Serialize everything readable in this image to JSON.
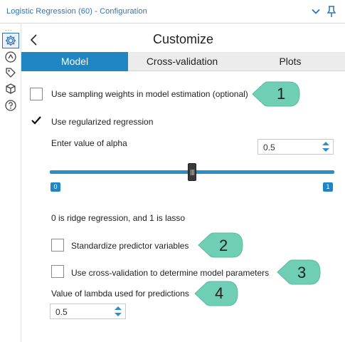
{
  "window": {
    "title": "Logistic Regression (60) - Configuration"
  },
  "rail": {
    "dots": "...",
    "icons": [
      "gear-icon",
      "workflow-icon",
      "tag-icon",
      "cube-icon",
      "help-icon"
    ]
  },
  "panel": {
    "heading": "Customize",
    "tabs": [
      {
        "label": "Model",
        "active": true
      },
      {
        "label": "Cross-validation",
        "active": false
      },
      {
        "label": "Plots",
        "active": false
      }
    ]
  },
  "options": {
    "sampling_weights": {
      "label": "Use sampling weights in model estimation (optional)",
      "checked": false
    },
    "regularized": {
      "label": "Use regularized regression",
      "checked": true
    },
    "alpha": {
      "label": "Enter value of alpha",
      "value": "0.5",
      "slider_min": "0",
      "slider_max": "1",
      "slider_value": 0.5
    },
    "alpha_note": "0 is ridge regression, and 1 is lasso",
    "standardize": {
      "label": "Standardize predictor variables",
      "checked": false
    },
    "cross_validation": {
      "label": "Use cross-validation to determine model parameters",
      "checked": false
    },
    "lambda": {
      "label": "Value of lambda used for predictions",
      "value": "0.5"
    }
  },
  "callouts": [
    "1",
    "2",
    "3",
    "4"
  ],
  "colors": {
    "accent": "#1f86c3",
    "callout_fill": "#6fcfb4",
    "title_text": "#2f73b8"
  }
}
